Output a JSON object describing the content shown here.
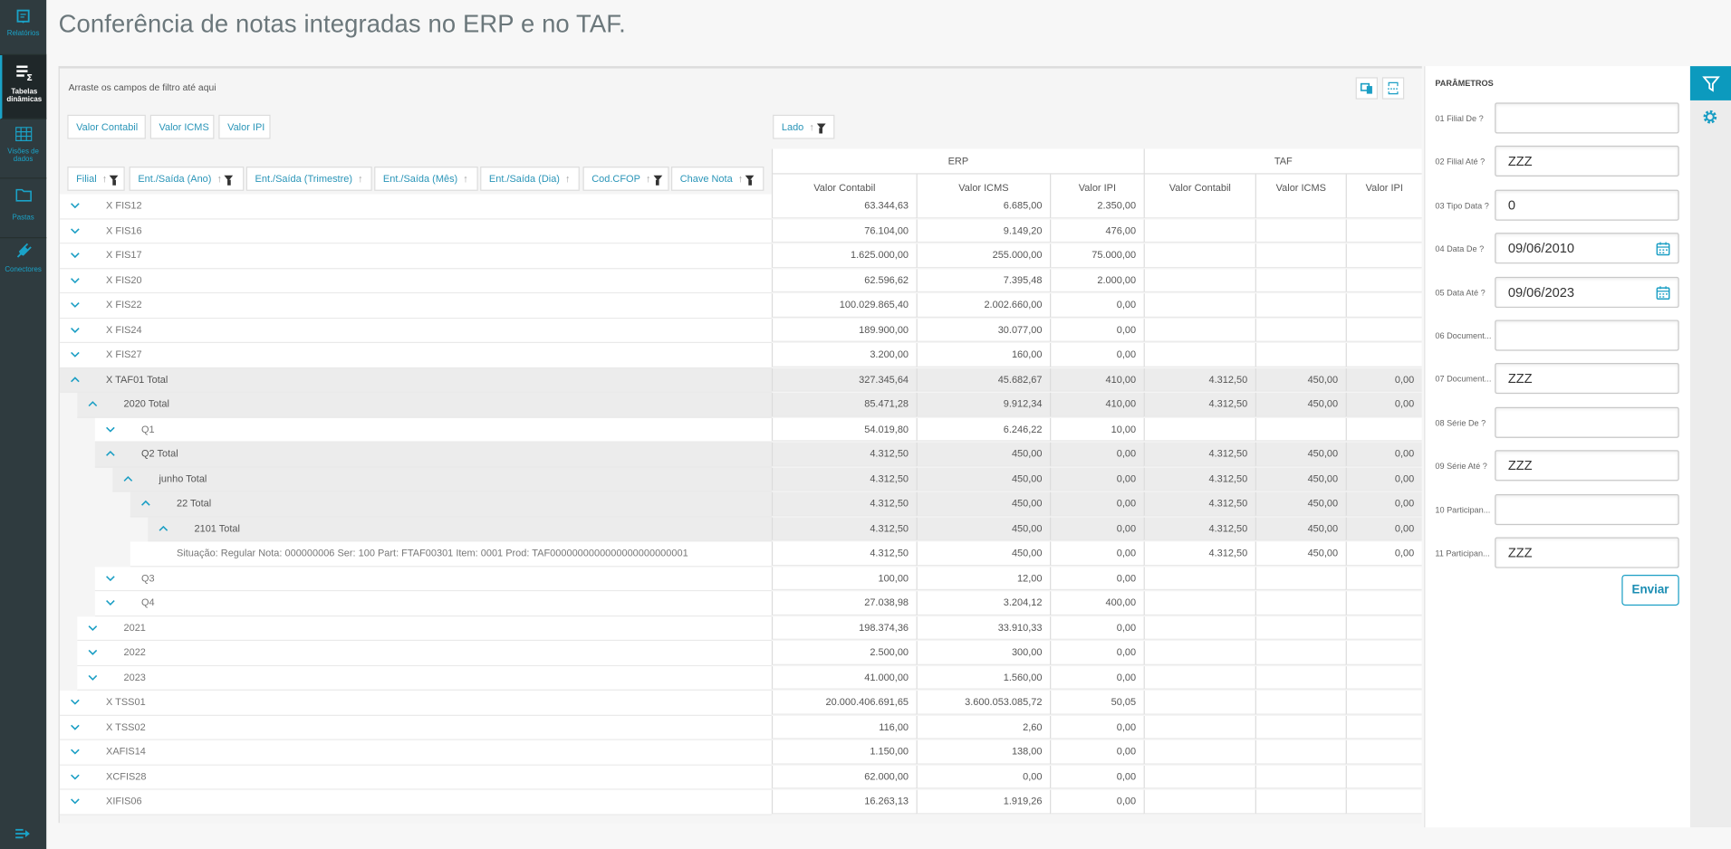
{
  "sidebar": {
    "items": [
      {
        "label": "Relatórios",
        "icon": "report-icon",
        "active": false
      },
      {
        "label": "Tabelas dinâmicas",
        "icon": "pivot-table-icon",
        "active": true
      },
      {
        "label": "Visões de dados",
        "icon": "grid-icon",
        "active": false
      },
      {
        "label": "Pastas",
        "icon": "folder-icon",
        "active": false
      },
      {
        "label": "Conectores",
        "icon": "plug-icon",
        "active": false
      }
    ],
    "bottom_icon": "expand-menu-icon"
  },
  "header": {
    "title": "Conferência de notas integradas no ERP e no TAF."
  },
  "pivot": {
    "filter_hint": "Arraste os campos de filtro até aqui",
    "toolbar_icons": [
      "export-icon",
      "print-icon"
    ],
    "value_fields": [
      "Valor Contabil",
      "Valor ICMS",
      "Valor IPI"
    ],
    "column_field": "Lado",
    "row_fields": [
      {
        "label": "Filial",
        "filter": true
      },
      {
        "label": "Ent./Saída (Ano)",
        "filter": true
      },
      {
        "label": "Ent./Saída (Trimestre)",
        "filter": false
      },
      {
        "label": "Ent./Saída (Mês)",
        "filter": false
      },
      {
        "label": "Ent./Saída (Dia)",
        "filter": false
      },
      {
        "label": "Cod.CFOP",
        "filter": true
      },
      {
        "label": "Chave Nota",
        "filter": true
      }
    ],
    "column_groups": [
      "ERP",
      "TAF"
    ],
    "measure_headers": [
      "Valor Contabil",
      "Valor ICMS",
      "Valor IPI",
      "Valor Contabil",
      "Valor ICMS",
      "Valor IPI"
    ],
    "rows": [
      {
        "level": 0,
        "label": "X FIS12",
        "expanded": false,
        "values": [
          "63.344,63",
          "6.685,00",
          "2.350,00",
          "",
          "",
          ""
        ]
      },
      {
        "level": 0,
        "label": "X FIS16",
        "expanded": false,
        "values": [
          "76.104,00",
          "9.149,20",
          "476,00",
          "",
          "",
          ""
        ]
      },
      {
        "level": 0,
        "label": "X FIS17",
        "expanded": false,
        "values": [
          "1.625.000,00",
          "255.000,00",
          "75.000,00",
          "",
          "",
          ""
        ]
      },
      {
        "level": 0,
        "label": "X FIS20",
        "expanded": false,
        "values": [
          "62.596,62",
          "7.395,48",
          "2.000,00",
          "",
          "",
          ""
        ]
      },
      {
        "level": 0,
        "label": "X FIS22",
        "expanded": false,
        "values": [
          "100.029.865,40",
          "2.002.660,00",
          "0,00",
          "",
          "",
          ""
        ]
      },
      {
        "level": 0,
        "label": "X FIS24",
        "expanded": false,
        "values": [
          "189.900,00",
          "30.077,00",
          "0,00",
          "",
          "",
          ""
        ]
      },
      {
        "level": 0,
        "label": "X FIS27",
        "expanded": false,
        "values": [
          "3.200,00",
          "160,00",
          "0,00",
          "",
          "",
          ""
        ]
      },
      {
        "level": 0,
        "label": "X TAF01 Total",
        "expanded": true,
        "values": [
          "327.345,64",
          "45.682,67",
          "410,00",
          "4.312,50",
          "450,00",
          "0,00"
        ]
      },
      {
        "level": 1,
        "label": "2020 Total",
        "expanded": true,
        "values": [
          "85.471,28",
          "9.912,34",
          "410,00",
          "4.312,50",
          "450,00",
          "0,00"
        ]
      },
      {
        "level": 2,
        "label": "Q1",
        "expanded": false,
        "values": [
          "54.019,80",
          "6.246,22",
          "10,00",
          "",
          "",
          ""
        ]
      },
      {
        "level": 2,
        "label": "Q2 Total",
        "expanded": true,
        "values": [
          "4.312,50",
          "450,00",
          "0,00",
          "4.312,50",
          "450,00",
          "0,00"
        ]
      },
      {
        "level": 3,
        "label": "junho Total",
        "expanded": true,
        "values": [
          "4.312,50",
          "450,00",
          "0,00",
          "4.312,50",
          "450,00",
          "0,00"
        ]
      },
      {
        "level": 4,
        "label": "22 Total",
        "expanded": true,
        "values": [
          "4.312,50",
          "450,00",
          "0,00",
          "4.312,50",
          "450,00",
          "0,00"
        ]
      },
      {
        "level": 5,
        "label": "2101 Total",
        "expanded": true,
        "values": [
          "4.312,50",
          "450,00",
          "0,00",
          "4.312,50",
          "450,00",
          "0,00"
        ]
      },
      {
        "level": 4,
        "label": "Situação: Regular Nota: 000000006 Ser: 100 Part: FTAF00301 Item: 0001 Prod: TAF0000000000000000000000001",
        "leaf": true,
        "values": [
          "4.312,50",
          "450,00",
          "0,00",
          "4.312,50",
          "450,00",
          "0,00"
        ]
      },
      {
        "level": 2,
        "label": "Q3",
        "expanded": false,
        "values": [
          "100,00",
          "12,00",
          "0,00",
          "",
          "",
          ""
        ]
      },
      {
        "level": 2,
        "label": "Q4",
        "expanded": false,
        "values": [
          "27.038,98",
          "3.204,12",
          "400,00",
          "",
          "",
          ""
        ]
      },
      {
        "level": 1,
        "label": "2021",
        "expanded": false,
        "values": [
          "198.374,36",
          "33.910,33",
          "0,00",
          "",
          "",
          ""
        ]
      },
      {
        "level": 1,
        "label": "2022",
        "expanded": false,
        "values": [
          "2.500,00",
          "300,00",
          "0,00",
          "",
          "",
          ""
        ]
      },
      {
        "level": 1,
        "label": "2023",
        "expanded": false,
        "values": [
          "41.000,00",
          "1.560,00",
          "0,00",
          "",
          "",
          ""
        ]
      },
      {
        "level": 0,
        "label": "X TSS01",
        "expanded": false,
        "values": [
          "20.000.406.691,65",
          "3.600.053.085,72",
          "50,05",
          "",
          "",
          ""
        ]
      },
      {
        "level": 0,
        "label": "X TSS02",
        "expanded": false,
        "values": [
          "116,00",
          "2,60",
          "0,00",
          "",
          "",
          ""
        ]
      },
      {
        "level": 0,
        "label": "XAFIS14",
        "expanded": false,
        "values": [
          "1.150,00",
          "138,00",
          "0,00",
          "",
          "",
          ""
        ]
      },
      {
        "level": 0,
        "label": "XCFIS28",
        "expanded": false,
        "values": [
          "62.000,00",
          "0,00",
          "0,00",
          "",
          "",
          ""
        ]
      },
      {
        "level": 0,
        "label": "XIFIS06",
        "expanded": false,
        "values": [
          "16.263,13",
          "1.919,26",
          "0,00",
          "",
          "",
          ""
        ]
      }
    ]
  },
  "params": {
    "title": "PARÂMETROS",
    "fields": [
      {
        "label": "01 Filial De ?",
        "value": ""
      },
      {
        "label": "02 Filial Até ?",
        "value": "ZZZ"
      },
      {
        "label": "03 Tipo Data ?",
        "value": "0"
      },
      {
        "label": "04 Data De ?",
        "value": "09/06/2010",
        "calendar": true
      },
      {
        "label": "05 Data Até ?",
        "value": "09/06/2023",
        "calendar": true
      },
      {
        "label": "06 Document...",
        "value": ""
      },
      {
        "label": "07 Document...",
        "value": "ZZZ"
      },
      {
        "label": "08 Série De ?",
        "value": ""
      },
      {
        "label": "09 Série Até ?",
        "value": "ZZZ"
      },
      {
        "label": "10 Participan...",
        "value": ""
      },
      {
        "label": "11 Participan...",
        "value": "ZZZ"
      }
    ],
    "submit_label": "Enviar"
  },
  "right_strip": {
    "icons": [
      "filter-icon",
      "gear-icon"
    ],
    "active": "filter-icon"
  },
  "colors": {
    "accent": "#1a9ec4",
    "sidebar": "#2f3b3f",
    "total_row": "#ececec"
  }
}
